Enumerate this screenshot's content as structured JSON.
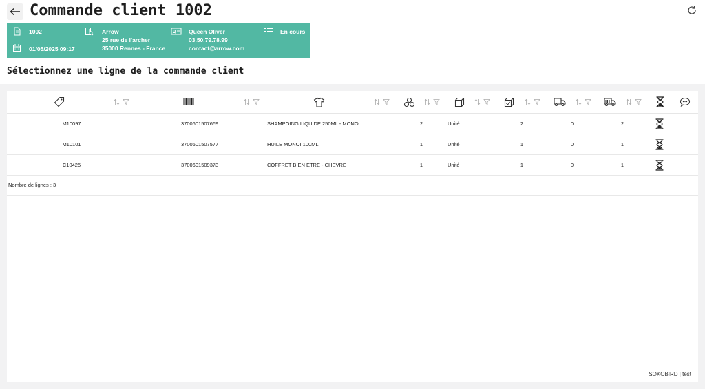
{
  "header": {
    "title": "Commande client 1002",
    "back_icon": "arrow-left-icon",
    "refresh_icon": "refresh-icon"
  },
  "order_card": {
    "accent_color": "#52b8a3",
    "order_number": "1002",
    "order_datetime": "01/05/2025 09:17",
    "customer_name": "Arrow",
    "address_line1": "25 rue de l'archer",
    "address_line2": "35000 Rennes - France",
    "contact_name": "Queen Oliver",
    "contact_phone": "03.50.79.78.99",
    "contact_email": "contact@arrow.com",
    "status": "En cours"
  },
  "subtitle": "Sélectionnez une ligne de la commande client",
  "table": {
    "columns": [
      {
        "icon": "tag-icon"
      },
      {
        "icon": "barcode-icon"
      },
      {
        "icon": "shirt-icon"
      },
      {
        "icon": "boxes-icon"
      },
      {
        "icon": "package-icon"
      },
      {
        "icon": "package-check-icon"
      },
      {
        "icon": "delivery-truck-icon"
      },
      {
        "icon": "delivery-truck-loaded-icon"
      },
      {
        "icon": "hourglass-icon"
      },
      {
        "icon": "comment-icon"
      }
    ],
    "rows": [
      {
        "reference": "M10097",
        "ean": "3700601507669",
        "designation": "SHAMPOING LIQUIDE 250ML - MONOI",
        "qty_ordered": "2",
        "unit": "Unité",
        "qty_prepared": "2",
        "qty_shipped": "0",
        "qty_remaining": "2",
        "status_icon": "hourglass-icon"
      },
      {
        "reference": "M10101",
        "ean": "3700601507577",
        "designation": "HUILE MONOI 100ML",
        "qty_ordered": "1",
        "unit": "Unité",
        "qty_prepared": "1",
        "qty_shipped": "0",
        "qty_remaining": "1",
        "status_icon": "hourglass-icon"
      },
      {
        "reference": "C10425",
        "ean": "3700601509373",
        "designation": "COFFRET BIEN ETRE - CHEVRE",
        "qty_ordered": "1",
        "unit": "Unité",
        "qty_prepared": "1",
        "qty_shipped": "0",
        "qty_remaining": "1",
        "status_icon": "hourglass-icon"
      }
    ],
    "row_count_label": "Nombre de lignes : 3"
  },
  "footer": "SOKOBIRD | test"
}
